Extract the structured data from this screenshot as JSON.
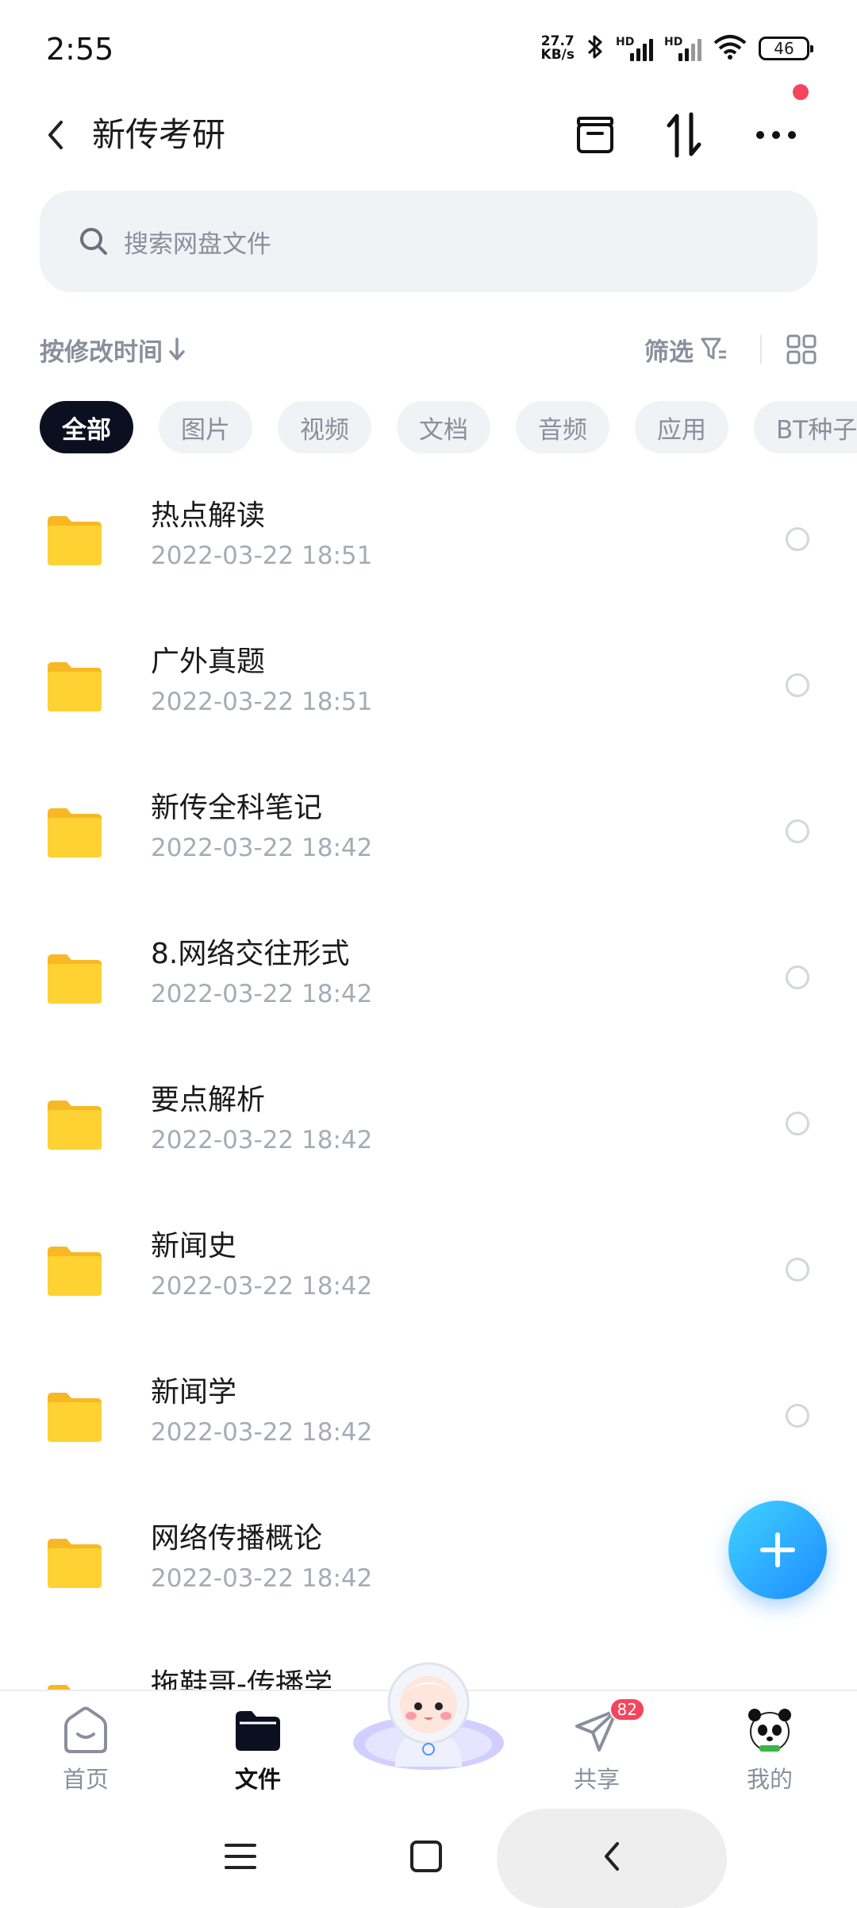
{
  "status_bar": {
    "time": "2:55",
    "net_speed_value": "27.7",
    "net_speed_unit": "KB/s",
    "hd_label": "HD",
    "battery": "46"
  },
  "header": {
    "title": "新传考研"
  },
  "search": {
    "placeholder": "搜索网盘文件"
  },
  "sort": {
    "label": "按修改时间",
    "filter_label": "筛选"
  },
  "chips": [
    {
      "label": "全部",
      "active": true
    },
    {
      "label": "图片"
    },
    {
      "label": "视频"
    },
    {
      "label": "文档"
    },
    {
      "label": "音频"
    },
    {
      "label": "应用"
    },
    {
      "label": "BT种子"
    }
  ],
  "files": [
    {
      "name": "热点解读",
      "date": "2022-03-22  18:51"
    },
    {
      "name": "广外真题",
      "date": "2022-03-22  18:51"
    },
    {
      "name": "新传全科笔记",
      "date": "2022-03-22  18:42"
    },
    {
      "name": "8.网络交往形式",
      "date": "2022-03-22  18:42"
    },
    {
      "name": "要点解析",
      "date": "2022-03-22  18:42"
    },
    {
      "name": "新闻史",
      "date": "2022-03-22  18:42"
    },
    {
      "name": "新闻学",
      "date": "2022-03-22  18:42"
    },
    {
      "name": "网络传播概论",
      "date": "2022-03-22  18:42"
    },
    {
      "name": "拖鞋哥-传播学",
      "date": ""
    }
  ],
  "bottom_nav": {
    "items": [
      {
        "label": "首页",
        "icon": "home-icon"
      },
      {
        "label": "文件",
        "icon": "folder-icon",
        "active": true
      },
      {
        "label": "共享",
        "icon": "send-icon",
        "badge": "82"
      },
      {
        "label": "我的",
        "icon": "panda-avatar-icon"
      }
    ]
  },
  "colors": {
    "accent": "#1e8bff",
    "badge": "#f5455c",
    "folder": "#ffcf2e",
    "chip_active_bg": "#0b0f1f"
  }
}
